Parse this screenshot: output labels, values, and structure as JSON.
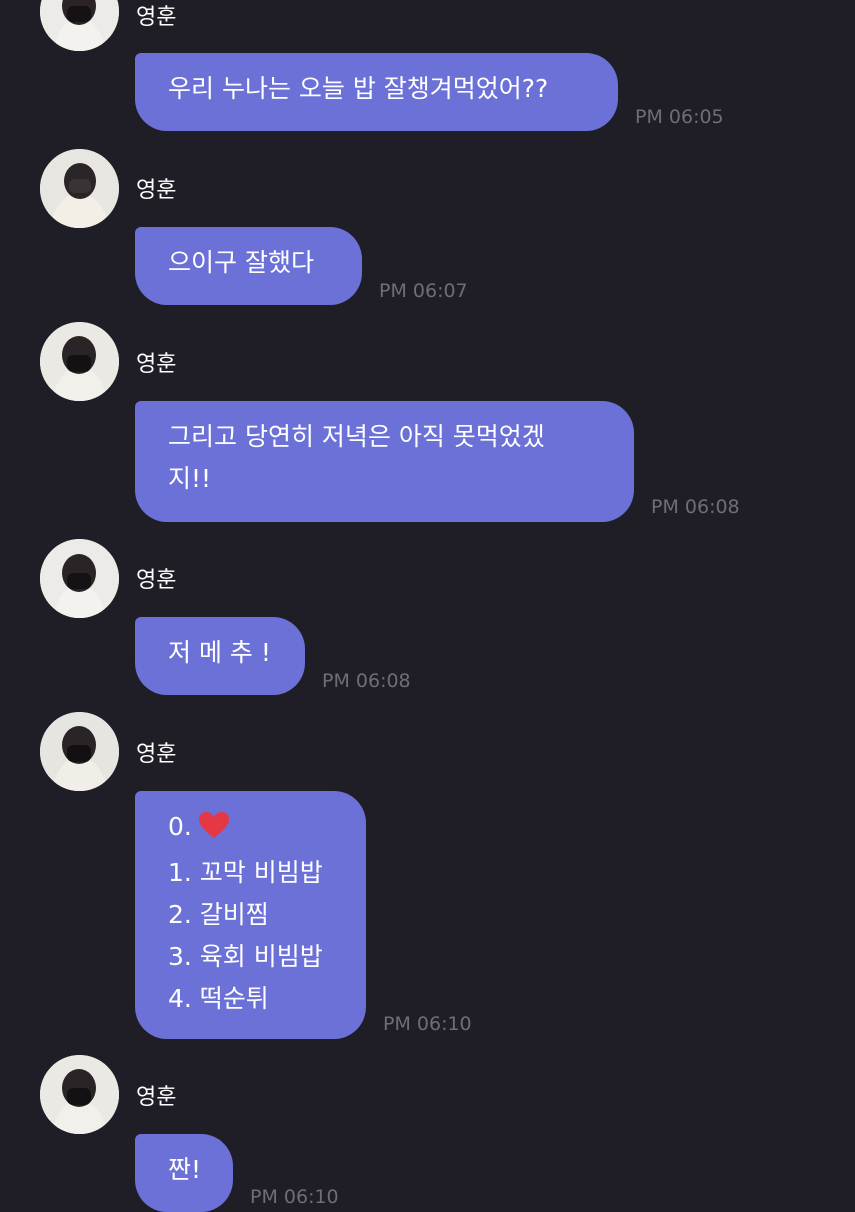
{
  "messages": [
    {
      "sender": "영훈",
      "lines": [
        "우리 누나는 오늘 밥 잘챙겨먹었어??"
      ],
      "time": "PM 06:05"
    },
    {
      "sender": "영훈",
      "lines": [
        "으이구 잘했다"
      ],
      "time": "PM 06:07"
    },
    {
      "sender": "영훈",
      "lines": [
        "그리고 당연히 저녁은 아직 못먹었겠",
        "지!!"
      ],
      "time": "PM 06:08"
    },
    {
      "sender": "영훈",
      "lines": [
        "저 메 추 !"
      ],
      "time": "PM 06:08"
    },
    {
      "sender": "영훈",
      "lines": [
        "0.",
        "1. 꼬막 비빔밥",
        "2. 갈비찜",
        "3. 육회 비빔밥",
        "4. 떡순튀"
      ],
      "time": "PM 06:10",
      "heart_icon": "red-heart-icon"
    },
    {
      "sender": "영훈",
      "lines": [
        "짠!"
      ],
      "time": "PM 06:10"
    }
  ],
  "colors": {
    "background": "#1f1e26",
    "bubble": "#6c71d8",
    "timestamp": "#6e6d78",
    "heart": "#e53845"
  }
}
